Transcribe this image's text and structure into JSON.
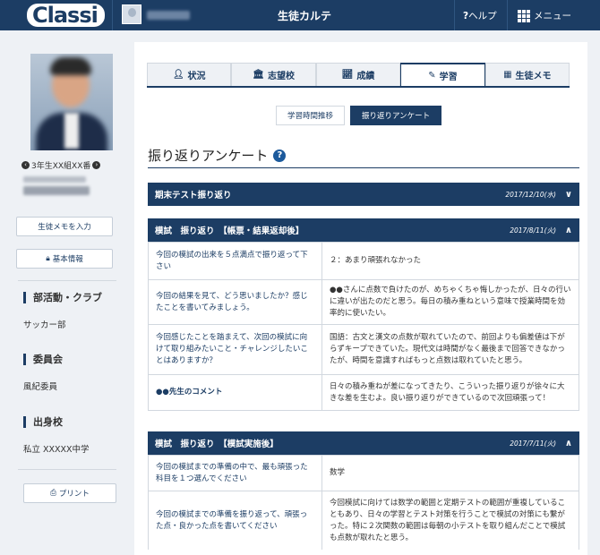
{
  "header": {
    "logo": "Classi",
    "title": "生徒カルテ",
    "help": "ヘルプ",
    "menu": "メニュー",
    "colors": {
      "navy": "#1c3d64",
      "logo_accent": "#2aa7dc"
    }
  },
  "sidebar": {
    "class_nav": "3年生XX組XX番",
    "memo_button": "生徒メモを入力",
    "info_button": "基本情報",
    "sections": [
      {
        "head": "部活動・クラブ",
        "value": "サッカー部"
      },
      {
        "head": "委員会",
        "value": "風紀委員"
      },
      {
        "head": "出身校",
        "value": "私立 XXXXX中学"
      }
    ],
    "print_button": "プリント"
  },
  "tabs": [
    {
      "label": "状況",
      "icon": "user-icon"
    },
    {
      "label": "志望校",
      "icon": "building-icon"
    },
    {
      "label": "成績",
      "icon": "chart-icon"
    },
    {
      "label": "学習",
      "icon": "pencil-icon",
      "active": true
    },
    {
      "label": "生徒メモ",
      "icon": "note-icon"
    }
  ],
  "subtabs": [
    "学習時間推移",
    "振り返りアンケート"
  ],
  "page_title": "振り返りアンケート",
  "sections": [
    {
      "title": "期末テスト振り返り",
      "date": "2017/12/10(水)",
      "chevron": "∨"
    },
    {
      "title": "模試　振り返り　【帳票・結果返却後】",
      "date": "2017/8/11(火)",
      "chevron": "∧",
      "rows": [
        {
          "q": "今回の模試の出来を５点満点で振り返って下さい",
          "a": "２：あまり頑張れなかった"
        },
        {
          "q": "今回の結果を見て、どう思いましたか？感じたことを書いてみましょう。",
          "a": "●●さんに点数で負けたのが、めちゃくちゃ悔しかったが、日々の行いに違いが出たのだと思う。毎日の積み重ねという意味で授業時間を効率的に使いたい。"
        },
        {
          "q": "今回感じたことを踏まえて、次回の模試に向けて取り組みたいこと・チャレンジしたいことはありますか？",
          "a": "国語：古文と漢文の点数が取れていたので、前回よりも偏差値は下がらずキープできていた。現代文は時間がなく最後まで回答できなかったが、時間を意識すればもっと点数は取れていたと思う。"
        },
        {
          "q": "●●先生のコメント",
          "a": "日々の積み重ねが差になってきたり、こういった振り返りが徐々に大きな差を生むよ。良い振り返りができているので次回頑張って！"
        }
      ]
    },
    {
      "title": "模試　振り返り　【模試実施後】",
      "date": "2017/7/11(火)",
      "chevron": "∧",
      "rows": [
        {
          "q": "今回の模試までの準備の中で、最も頑張った科目を１つ選んでください",
          "a": "数学"
        },
        {
          "q": "今回の模試までの準備を振り返って、頑張った点・良かった点を書いてください",
          "a": "今回模試に向けては数学の範囲と定期テストの範囲が重複していることもあり、日々の学習とテスト対策を行うことで模試の対策にも繋がった。特に２次関数の範囲は毎朝の小テストを取り組んだことで模試も点数が取れたと思う。"
        }
      ]
    }
  ]
}
